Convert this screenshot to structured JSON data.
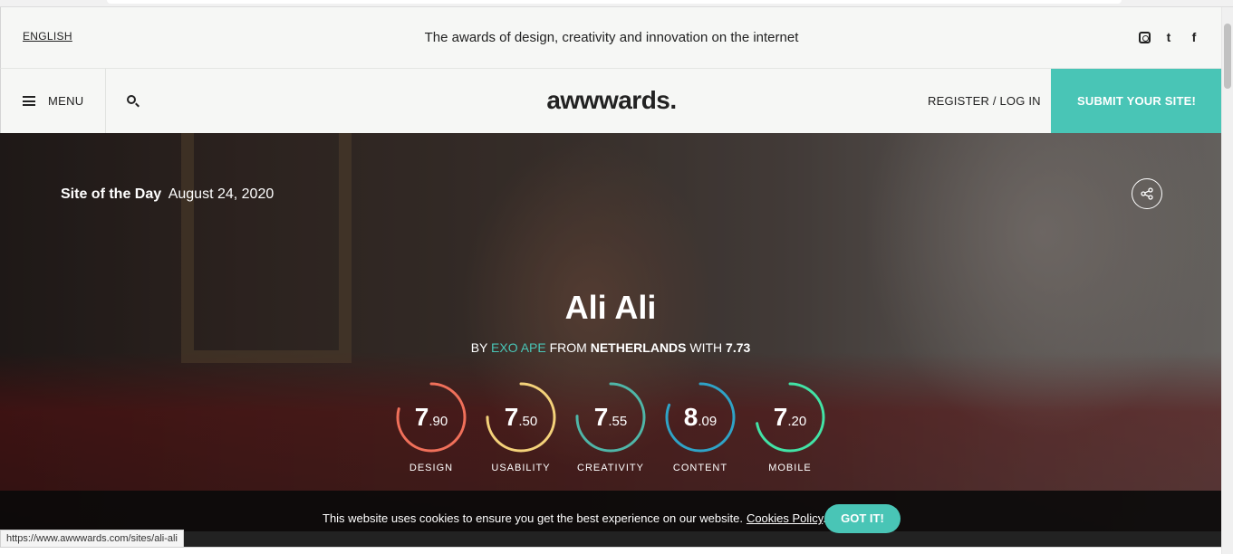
{
  "header": {
    "language": "ENGLISH",
    "tagline": "The awards of design, creativity and innovation on the internet",
    "social": [
      "instagram-icon",
      "twitter-icon",
      "facebook-icon"
    ],
    "twitter_glyph": "t",
    "facebook_glyph": "f"
  },
  "nav": {
    "menu_label": "MENU",
    "logo": "awwwards.",
    "register_label": "REGISTER / LOG IN",
    "submit_label": "SUBMIT YOUR SITE!"
  },
  "hero": {
    "sotd_label": "Site of the Day",
    "date": "August 24, 2020",
    "title": "Ali Ali",
    "by_prefix": "BY",
    "author": "EXO APE",
    "from_prefix": "FROM",
    "country": "NETHERLANDS",
    "with_prefix": "WITH",
    "overall_score": "7.73",
    "scores": [
      {
        "label": "DESIGN",
        "whole": "7",
        "decimal": ".90",
        "value": 7.9,
        "color": "#f0705a"
      },
      {
        "label": "USABILITY",
        "whole": "7",
        "decimal": ".50",
        "value": 7.5,
        "color": "#f4d27a"
      },
      {
        "label": "CREATIVITY",
        "whole": "7",
        "decimal": ".55",
        "value": 7.55,
        "color": "#4fb6a8"
      },
      {
        "label": "CONTENT",
        "whole": "8",
        "decimal": ".09",
        "value": 8.09,
        "color": "#2fa3c7"
      },
      {
        "label": "MOBILE",
        "whole": "7",
        "decimal": ".20",
        "value": 7.2,
        "color": "#42e3a6"
      }
    ]
  },
  "cookie": {
    "message": "This website uses cookies to ensure you get the best experience on our website.",
    "policy_link": "Cookies Policy",
    "period": ".",
    "accept_label": "GOT IT!"
  },
  "status_bar": {
    "url": "https://www.awwwards.com/sites/ali-ali"
  }
}
